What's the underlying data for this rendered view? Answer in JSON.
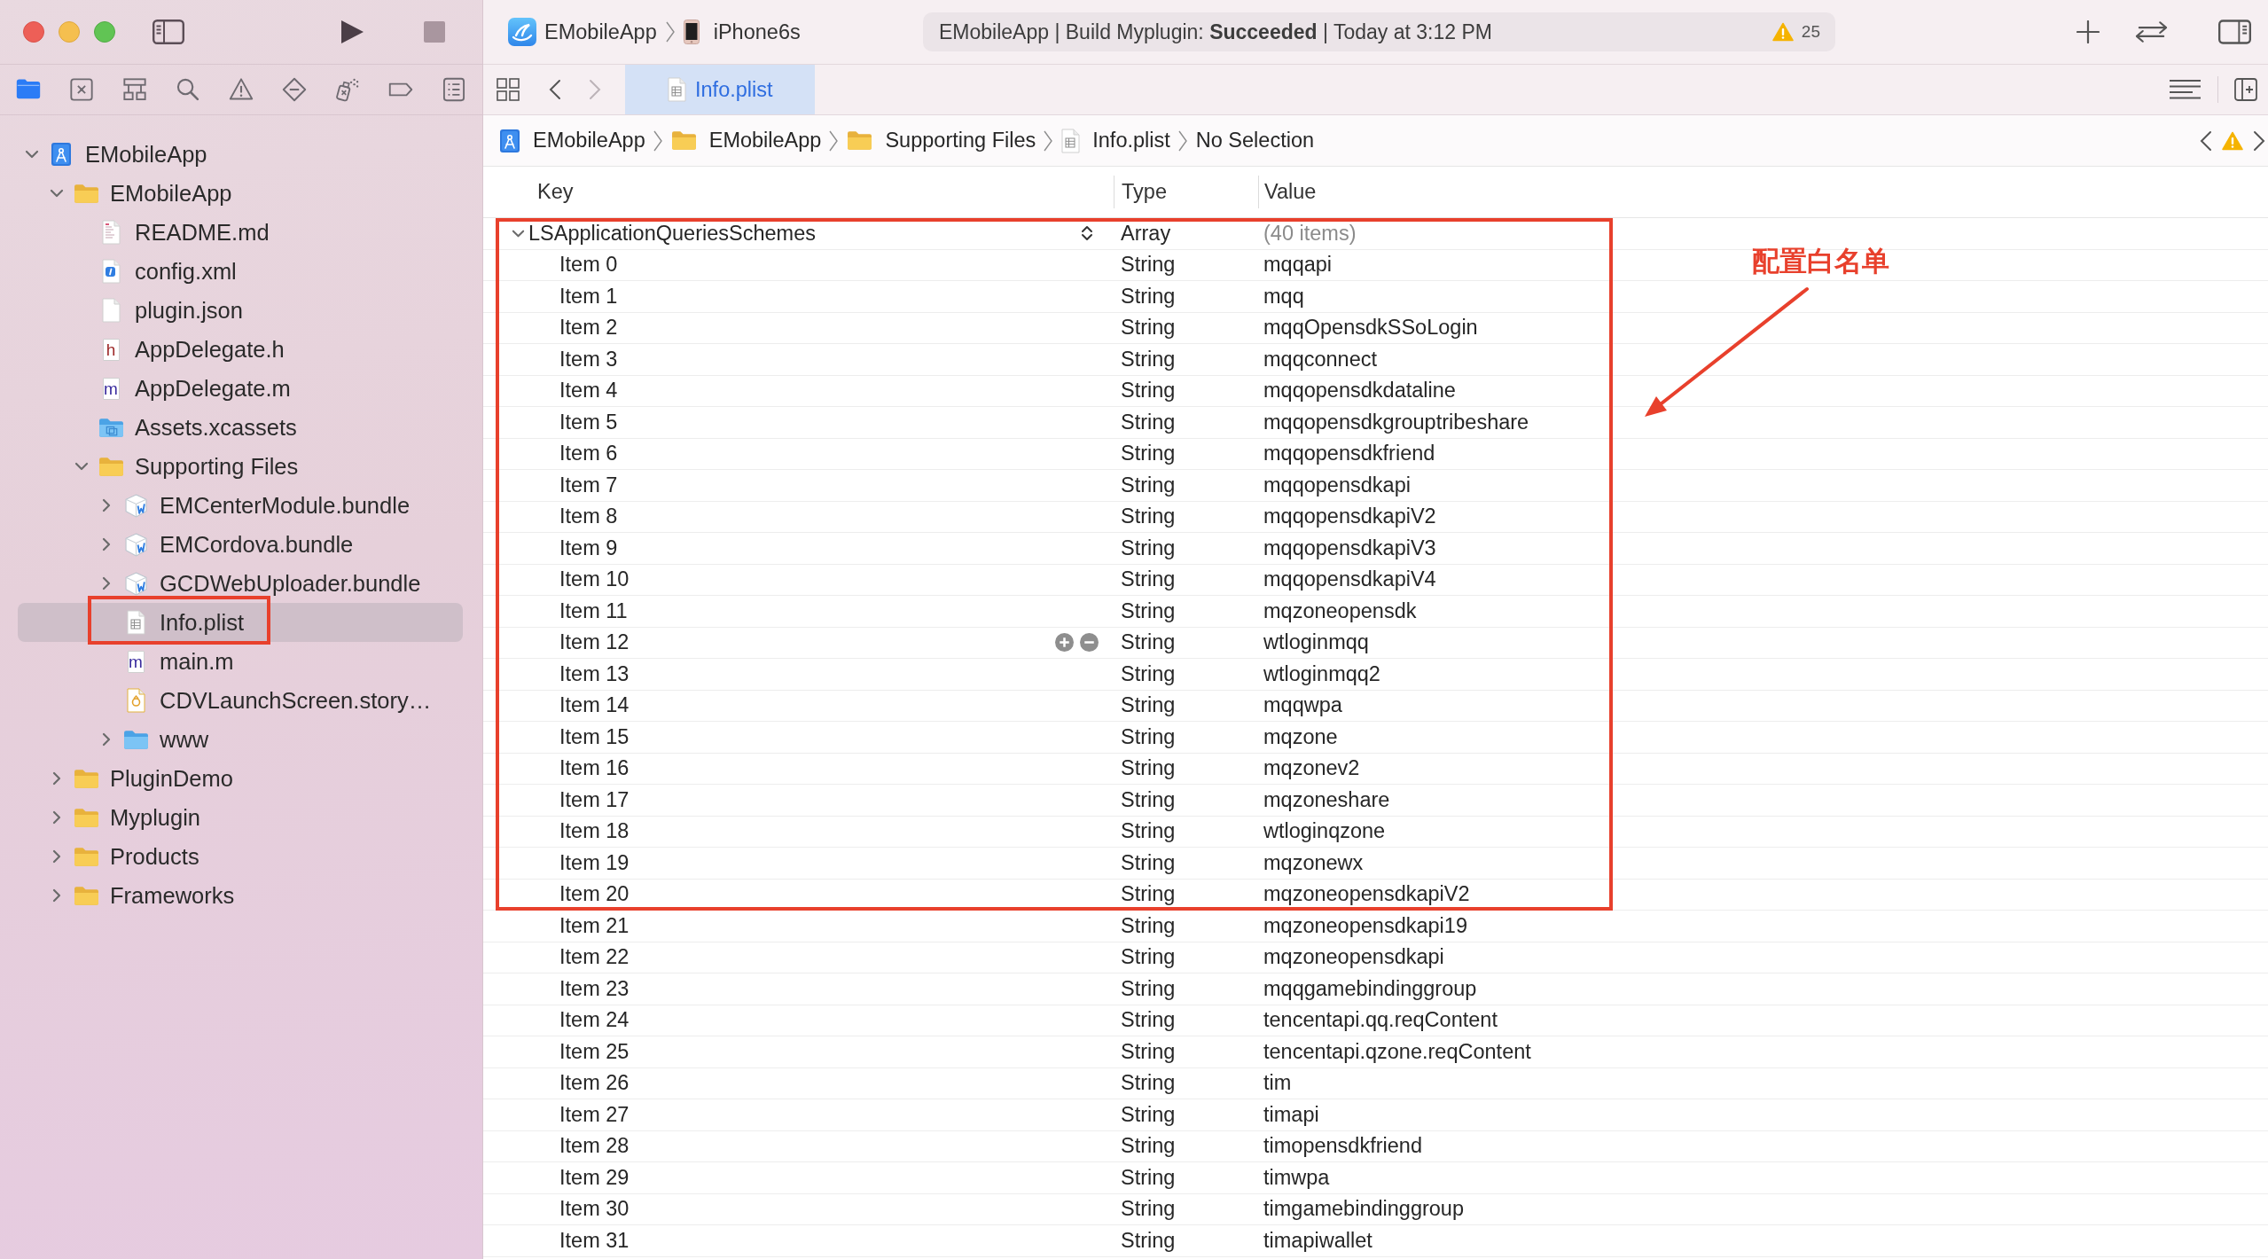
{
  "toolbar": {
    "scheme": "EMobileApp",
    "device": "iPhone6s",
    "status": "EMobileApp | Build Myplugin: **Succeeded** | Today at 3:12 PM",
    "warning_count": "25",
    "stop_disabled": true
  },
  "navigator_tabs": [
    {
      "kind": "files",
      "selected": true
    },
    {
      "kind": "changes",
      "selected": false
    },
    {
      "kind": "symbols",
      "selected": false
    },
    {
      "kind": "find",
      "selected": false
    },
    {
      "kind": "issues",
      "selected": false
    },
    {
      "kind": "tests",
      "selected": false
    },
    {
      "kind": "debug",
      "selected": false
    },
    {
      "kind": "breakpoints",
      "selected": false
    },
    {
      "kind": "reports",
      "selected": false
    }
  ],
  "navigator": {
    "items": [
      {
        "label": "EMobileApp",
        "kind": "project",
        "expanded": true,
        "selected": false,
        "boxed": false,
        "children": [
          {
            "label": "EMobileApp",
            "kind": "folder",
            "expanded": true,
            "selected": false,
            "boxed": false,
            "children": [
              {
                "label": "README.md",
                "kind": "markdown",
                "selected": false,
                "boxed": false
              },
              {
                "label": "config.xml",
                "kind": "xml",
                "selected": false,
                "boxed": false
              },
              {
                "label": "plugin.json",
                "kind": "blank",
                "selected": false,
                "boxed": false
              },
              {
                "label": "AppDelegate.h",
                "kind": "header",
                "glyph": "h",
                "selected": false,
                "boxed": false
              },
              {
                "label": "AppDelegate.m",
                "kind": "source",
                "glyph": "m",
                "selected": false,
                "boxed": false
              },
              {
                "label": "Assets.xcassets",
                "kind": "assets",
                "selected": false,
                "boxed": false
              },
              {
                "label": "Supporting Files",
                "kind": "folder",
                "expanded": true,
                "selected": false,
                "boxed": false,
                "children": [
                  {
                    "label": "EMCenterModule.bundle",
                    "kind": "bundle",
                    "expanded": false,
                    "selected": false,
                    "boxed": false
                  },
                  {
                    "label": "EMCordova.bundle",
                    "kind": "bundle",
                    "expanded": false,
                    "selected": false,
                    "boxed": false
                  },
                  {
                    "label": "GCDWebUploader.bundle",
                    "kind": "bundle",
                    "expanded": false,
                    "selected": false,
                    "boxed": false
                  },
                  {
                    "label": "Info.plist",
                    "kind": "plist",
                    "selected": true,
                    "boxed": true
                  },
                  {
                    "label": "main.m",
                    "kind": "source",
                    "glyph": "m",
                    "selected": false,
                    "boxed": false
                  },
                  {
                    "label": "CDVLaunchScreen.story…",
                    "kind": "storyboard",
                    "selected": false,
                    "boxed": false
                  },
                  {
                    "label": "www",
                    "kind": "bluefolder",
                    "expanded": false,
                    "selected": false,
                    "boxed": false
                  }
                ]
              }
            ]
          },
          {
            "label": "PluginDemo",
            "kind": "folder",
            "expanded": false,
            "selected": false,
            "boxed": false
          },
          {
            "label": "Myplugin",
            "kind": "folder",
            "expanded": false,
            "selected": false,
            "boxed": false
          },
          {
            "label": "Products",
            "kind": "folder",
            "expanded": false,
            "selected": false,
            "boxed": false
          },
          {
            "label": "Frameworks",
            "kind": "folder",
            "expanded": false,
            "selected": false,
            "boxed": false
          }
        ]
      }
    ]
  },
  "history": {
    "back_disabled": false,
    "forward_disabled": true
  },
  "editor_tabs": [
    {
      "label": "Info.plist",
      "selected": true
    }
  ],
  "jump_bar": [
    {
      "label": "EMobileApp",
      "kind": "project"
    },
    {
      "label": "EMobileApp",
      "kind": "folder"
    },
    {
      "label": "Supporting Files",
      "kind": "folder"
    },
    {
      "label": "Info.plist",
      "kind": "plist"
    },
    {
      "label": "No Selection",
      "kind": "none"
    }
  ],
  "table": {
    "columns": [
      "Key",
      "Type",
      "Value"
    ],
    "rows": [
      {
        "key": "LSApplicationQueriesSchemes",
        "type": "Array",
        "value": "(40 items)",
        "kind": "array",
        "expanded": true,
        "boxed": true,
        "hovered": false,
        "children": [
          {
            "key": "Item 0",
            "type": "String",
            "value": "mqqapi",
            "kind": "string",
            "boxed": true,
            "hovered": false
          },
          {
            "key": "Item 1",
            "type": "String",
            "value": "mqq",
            "kind": "string",
            "boxed": true,
            "hovered": false
          },
          {
            "key": "Item 2",
            "type": "String",
            "value": "mqqOpensdkSSoLogin",
            "kind": "string",
            "boxed": true,
            "hovered": false
          },
          {
            "key": "Item 3",
            "type": "String",
            "value": "mqqconnect",
            "kind": "string",
            "boxed": true,
            "hovered": false
          },
          {
            "key": "Item 4",
            "type": "String",
            "value": "mqqopensdkdataline",
            "kind": "string",
            "boxed": true,
            "hovered": false
          },
          {
            "key": "Item 5",
            "type": "String",
            "value": "mqqopensdkgrouptribeshare",
            "kind": "string",
            "boxed": true,
            "hovered": false
          },
          {
            "key": "Item 6",
            "type": "String",
            "value": "mqqopensdkfriend",
            "kind": "string",
            "boxed": true,
            "hovered": false
          },
          {
            "key": "Item 7",
            "type": "String",
            "value": "mqqopensdkapi",
            "kind": "string",
            "boxed": true,
            "hovered": false
          },
          {
            "key": "Item 8",
            "type": "String",
            "value": "mqqopensdkapiV2",
            "kind": "string",
            "boxed": true,
            "hovered": false
          },
          {
            "key": "Item 9",
            "type": "String",
            "value": "mqqopensdkapiV3",
            "kind": "string",
            "boxed": true,
            "hovered": false
          },
          {
            "key": "Item 10",
            "type": "String",
            "value": "mqqopensdkapiV4",
            "kind": "string",
            "boxed": true,
            "hovered": false
          },
          {
            "key": "Item 11",
            "type": "String",
            "value": "mqzoneopensdk",
            "kind": "string",
            "boxed": true,
            "hovered": false
          },
          {
            "key": "Item 12",
            "type": "String",
            "value": "wtloginmqq",
            "kind": "string",
            "boxed": true,
            "hovered": true
          },
          {
            "key": "Item 13",
            "type": "String",
            "value": "wtloginmqq2",
            "kind": "string",
            "boxed": true,
            "hovered": false
          },
          {
            "key": "Item 14",
            "type": "String",
            "value": "mqqwpa",
            "kind": "string",
            "boxed": true,
            "hovered": false
          },
          {
            "key": "Item 15",
            "type": "String",
            "value": "mqzone",
            "kind": "string",
            "boxed": true,
            "hovered": false
          },
          {
            "key": "Item 16",
            "type": "String",
            "value": "mqzonev2",
            "kind": "string",
            "boxed": true,
            "hovered": false
          },
          {
            "key": "Item 17",
            "type": "String",
            "value": "mqzoneshare",
            "kind": "string",
            "boxed": true,
            "hovered": false
          },
          {
            "key": "Item 18",
            "type": "String",
            "value": "wtloginqzone",
            "kind": "string",
            "boxed": true,
            "hovered": false
          },
          {
            "key": "Item 19",
            "type": "String",
            "value": "mqzonewx",
            "kind": "string",
            "boxed": true,
            "hovered": false
          },
          {
            "key": "Item 20",
            "type": "String",
            "value": "mqzoneopensdkapiV2",
            "kind": "string",
            "boxed": true,
            "hovered": false
          },
          {
            "key": "Item 21",
            "type": "String",
            "value": "mqzoneopensdkapi19",
            "kind": "string",
            "boxed": false,
            "hovered": false
          },
          {
            "key": "Item 22",
            "type": "String",
            "value": "mqzoneopensdkapi",
            "kind": "string",
            "boxed": false,
            "hovered": false
          },
          {
            "key": "Item 23",
            "type": "String",
            "value": "mqqgamebindinggroup",
            "kind": "string",
            "boxed": false,
            "hovered": false
          },
          {
            "key": "Item 24",
            "type": "String",
            "value": "tencentapi.qq.reqContent",
            "kind": "string",
            "boxed": false,
            "hovered": false
          },
          {
            "key": "Item 25",
            "type": "String",
            "value": "tencentapi.qzone.reqContent",
            "kind": "string",
            "boxed": false,
            "hovered": false
          },
          {
            "key": "Item 26",
            "type": "String",
            "value": "tim",
            "kind": "string",
            "boxed": false,
            "hovered": false
          },
          {
            "key": "Item 27",
            "type": "String",
            "value": "timapi",
            "kind": "string",
            "boxed": false,
            "hovered": false
          },
          {
            "key": "Item 28",
            "type": "String",
            "value": "timopensdkfriend",
            "kind": "string",
            "boxed": false,
            "hovered": false
          },
          {
            "key": "Item 29",
            "type": "String",
            "value": "timwpa",
            "kind": "string",
            "boxed": false,
            "hovered": false
          },
          {
            "key": "Item 30",
            "type": "String",
            "value": "timgamebindinggroup",
            "kind": "string",
            "boxed": false,
            "hovered": false
          },
          {
            "key": "Item 31",
            "type": "String",
            "value": "timapiwallet",
            "kind": "string",
            "boxed": false,
            "hovered": false
          }
        ]
      }
    ]
  },
  "annotation": {
    "label": "配置白名单"
  }
}
